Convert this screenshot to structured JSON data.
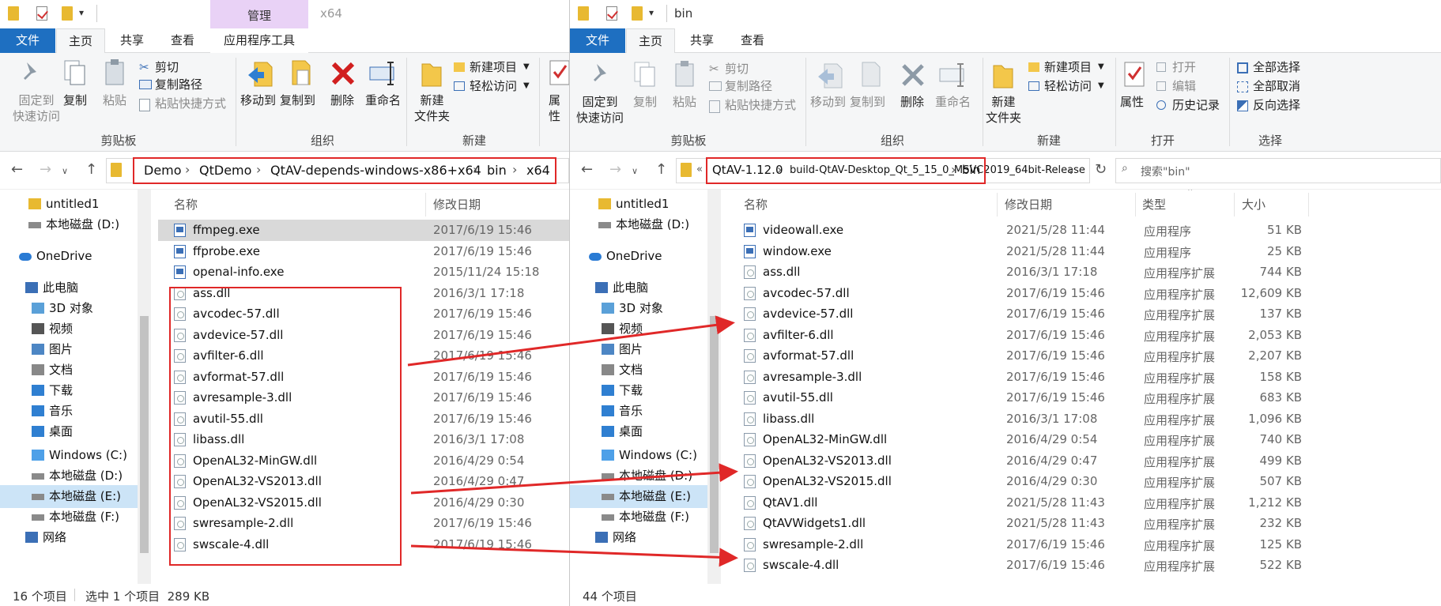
{
  "left": {
    "title": "x64",
    "context_tab": "管理",
    "tabs": [
      "文件",
      "主页",
      "共享",
      "查看",
      "应用程序工具"
    ],
    "ribbon": {
      "pin": "固定到\n快速访问",
      "copy": "复制",
      "paste": "粘贴",
      "cut": "剪切",
      "copy_path": "复制路径",
      "paste_shortcut": "粘贴快捷方式",
      "clipboard_group": "剪贴板",
      "move_to": "移动到",
      "copy_to": "复制到",
      "delete": "删除",
      "rename": "重命名",
      "organize_group": "组织",
      "new_folder": "新建\n文件夹",
      "new_item": "新建项目",
      "easy_access": "轻松访问",
      "new_group": "新建",
      "properties": "属性"
    },
    "breadcrumb": [
      "Demo",
      "QtDemo",
      "QtAV-depends-windows-x86+x64",
      "bin",
      "x64"
    ],
    "nav": [
      {
        "label": "untitled1",
        "icon": "folder-icon"
      },
      {
        "label": "本地磁盘 (D:)",
        "icon": "drive-icon"
      },
      {
        "label": "OneDrive",
        "icon": "cloud-icon"
      },
      {
        "label": "此电脑",
        "icon": "computer-icon"
      },
      {
        "label": "3D 对象",
        "icon": "3d-objects-icon"
      },
      {
        "label": "视频",
        "icon": "video-icon"
      },
      {
        "label": "图片",
        "icon": "pictures-icon"
      },
      {
        "label": "文档",
        "icon": "documents-icon"
      },
      {
        "label": "下载",
        "icon": "download-icon"
      },
      {
        "label": "音乐",
        "icon": "music-icon"
      },
      {
        "label": "桌面",
        "icon": "desktop-icon"
      },
      {
        "label": "Windows (C:)",
        "icon": "windows-drive-icon"
      },
      {
        "label": "本地磁盘 (D:)",
        "icon": "drive-icon"
      },
      {
        "label": "本地磁盘 (E:)",
        "icon": "drive-icon"
      },
      {
        "label": "本地磁盘 (F:)",
        "icon": "drive-icon"
      },
      {
        "label": "网络",
        "icon": "network-icon"
      }
    ],
    "columns": {
      "name": "名称",
      "date": "修改日期"
    },
    "files": [
      {
        "name": "ffmpeg.exe",
        "date": "2017/6/19 15:46",
        "kind": "exe"
      },
      {
        "name": "ffprobe.exe",
        "date": "2017/6/19 15:46",
        "kind": "exe"
      },
      {
        "name": "openal-info.exe",
        "date": "2015/11/24 15:18",
        "kind": "exe"
      },
      {
        "name": "ass.dll",
        "date": "2016/3/1 17:18",
        "kind": "dll"
      },
      {
        "name": "avcodec-57.dll",
        "date": "2017/6/19 15:46",
        "kind": "dll"
      },
      {
        "name": "avdevice-57.dll",
        "date": "2017/6/19 15:46",
        "kind": "dll"
      },
      {
        "name": "avfilter-6.dll",
        "date": "2017/6/19 15:46",
        "kind": "dll"
      },
      {
        "name": "avformat-57.dll",
        "date": "2017/6/19 15:46",
        "kind": "dll"
      },
      {
        "name": "avresample-3.dll",
        "date": "2017/6/19 15:46",
        "kind": "dll"
      },
      {
        "name": "avutil-55.dll",
        "date": "2017/6/19 15:46",
        "kind": "dll"
      },
      {
        "name": "libass.dll",
        "date": "2016/3/1 17:08",
        "kind": "dll"
      },
      {
        "name": "OpenAL32-MinGW.dll",
        "date": "2016/4/29 0:54",
        "kind": "dll"
      },
      {
        "name": "OpenAL32-VS2013.dll",
        "date": "2016/4/29 0:47",
        "kind": "dll"
      },
      {
        "name": "OpenAL32-VS2015.dll",
        "date": "2016/4/29 0:30",
        "kind": "dll"
      },
      {
        "name": "swresample-2.dll",
        "date": "2017/6/19 15:46",
        "kind": "dll"
      },
      {
        "name": "swscale-4.dll",
        "date": "2017/6/19 15:46",
        "kind": "dll"
      }
    ],
    "status": {
      "count": "16 个项目",
      "selection": "选中 1 个项目  289 KB"
    }
  },
  "right": {
    "title": "bin",
    "tabs": [
      "文件",
      "主页",
      "共享",
      "查看"
    ],
    "ribbon": {
      "pin": "固定到\n快速访问",
      "copy": "复制",
      "paste": "粘贴",
      "cut": "剪切",
      "copy_path": "复制路径",
      "paste_shortcut": "粘贴快捷方式",
      "clipboard_group": "剪贴板",
      "move_to": "移动到",
      "copy_to": "复制到",
      "delete": "删除",
      "rename": "重命名",
      "organize_group": "组织",
      "new_folder": "新建\n文件夹",
      "new_item": "新建项目",
      "easy_access": "轻松访问",
      "new_group": "新建",
      "properties": "属性",
      "open": "打开",
      "edit": "编辑",
      "history": "历史记录",
      "open_group": "打开",
      "select_all": "全部选择",
      "select_none": "全部取消",
      "invert_selection": "反向选择",
      "select_group": "选择"
    },
    "breadcrumb": [
      "QtAV-1.12.0",
      "build-QtAV-Desktop_Qt_5_15_0_MSVC2019_64bit-Release",
      "bin"
    ],
    "search_placeholder": "搜索\"bin\"",
    "nav": [
      {
        "label": "untitled1",
        "icon": "folder-icon"
      },
      {
        "label": "本地磁盘 (D:)",
        "icon": "drive-icon"
      },
      {
        "label": "OneDrive",
        "icon": "cloud-icon"
      },
      {
        "label": "此电脑",
        "icon": "computer-icon"
      },
      {
        "label": "3D 对象",
        "icon": "3d-objects-icon"
      },
      {
        "label": "视频",
        "icon": "video-icon"
      },
      {
        "label": "图片",
        "icon": "pictures-icon"
      },
      {
        "label": "文档",
        "icon": "documents-icon"
      },
      {
        "label": "下载",
        "icon": "download-icon"
      },
      {
        "label": "音乐",
        "icon": "music-icon"
      },
      {
        "label": "桌面",
        "icon": "desktop-icon"
      },
      {
        "label": "Windows (C:)",
        "icon": "windows-drive-icon"
      },
      {
        "label": "本地磁盘 (D:)",
        "icon": "drive-icon"
      },
      {
        "label": "本地磁盘 (E:)",
        "icon": "drive-icon"
      },
      {
        "label": "本地磁盘 (F:)",
        "icon": "drive-icon"
      },
      {
        "label": "网络",
        "icon": "network-icon"
      }
    ],
    "columns": {
      "name": "名称",
      "date": "修改日期",
      "type": "类型",
      "size": "大小"
    },
    "files": [
      {
        "name": "videowall.exe",
        "date": "2021/5/28 11:44",
        "type": "应用程序",
        "size": "51 KB",
        "kind": "exe"
      },
      {
        "name": "window.exe",
        "date": "2021/5/28 11:44",
        "type": "应用程序",
        "size": "25 KB",
        "kind": "exe"
      },
      {
        "name": "ass.dll",
        "date": "2016/3/1 17:18",
        "type": "应用程序扩展",
        "size": "744 KB",
        "kind": "dll"
      },
      {
        "name": "avcodec-57.dll",
        "date": "2017/6/19 15:46",
        "type": "应用程序扩展",
        "size": "12,609 KB",
        "kind": "dll"
      },
      {
        "name": "avdevice-57.dll",
        "date": "2017/6/19 15:46",
        "type": "应用程序扩展",
        "size": "137 KB",
        "kind": "dll"
      },
      {
        "name": "avfilter-6.dll",
        "date": "2017/6/19 15:46",
        "type": "应用程序扩展",
        "size": "2,053 KB",
        "kind": "dll"
      },
      {
        "name": "avformat-57.dll",
        "date": "2017/6/19 15:46",
        "type": "应用程序扩展",
        "size": "2,207 KB",
        "kind": "dll"
      },
      {
        "name": "avresample-3.dll",
        "date": "2017/6/19 15:46",
        "type": "应用程序扩展",
        "size": "158 KB",
        "kind": "dll"
      },
      {
        "name": "avutil-55.dll",
        "date": "2017/6/19 15:46",
        "type": "应用程序扩展",
        "size": "683 KB",
        "kind": "dll"
      },
      {
        "name": "libass.dll",
        "date": "2016/3/1 17:08",
        "type": "应用程序扩展",
        "size": "1,096 KB",
        "kind": "dll"
      },
      {
        "name": "OpenAL32-MinGW.dll",
        "date": "2016/4/29 0:54",
        "type": "应用程序扩展",
        "size": "740 KB",
        "kind": "dll"
      },
      {
        "name": "OpenAL32-VS2013.dll",
        "date": "2016/4/29 0:47",
        "type": "应用程序扩展",
        "size": "499 KB",
        "kind": "dll"
      },
      {
        "name": "OpenAL32-VS2015.dll",
        "date": "2016/4/29 0:30",
        "type": "应用程序扩展",
        "size": "507 KB",
        "kind": "dll"
      },
      {
        "name": "QtAV1.dll",
        "date": "2021/5/28 11:43",
        "type": "应用程序扩展",
        "size": "1,212 KB",
        "kind": "dll"
      },
      {
        "name": "QtAVWidgets1.dll",
        "date": "2021/5/28 11:43",
        "type": "应用程序扩展",
        "size": "232 KB",
        "kind": "dll"
      },
      {
        "name": "swresample-2.dll",
        "date": "2017/6/19 15:46",
        "type": "应用程序扩展",
        "size": "125 KB",
        "kind": "dll"
      },
      {
        "name": "swscale-4.dll",
        "date": "2017/6/19 15:46",
        "type": "应用程序扩展",
        "size": "522 KB",
        "kind": "dll"
      }
    ],
    "status": {
      "count": "44 个项目"
    }
  },
  "colors": {
    "file_tab": "#1e6fc1",
    "context_tab": "#e9d2f6",
    "annotation_red": "#e02828",
    "selection": "#cce4f7"
  }
}
